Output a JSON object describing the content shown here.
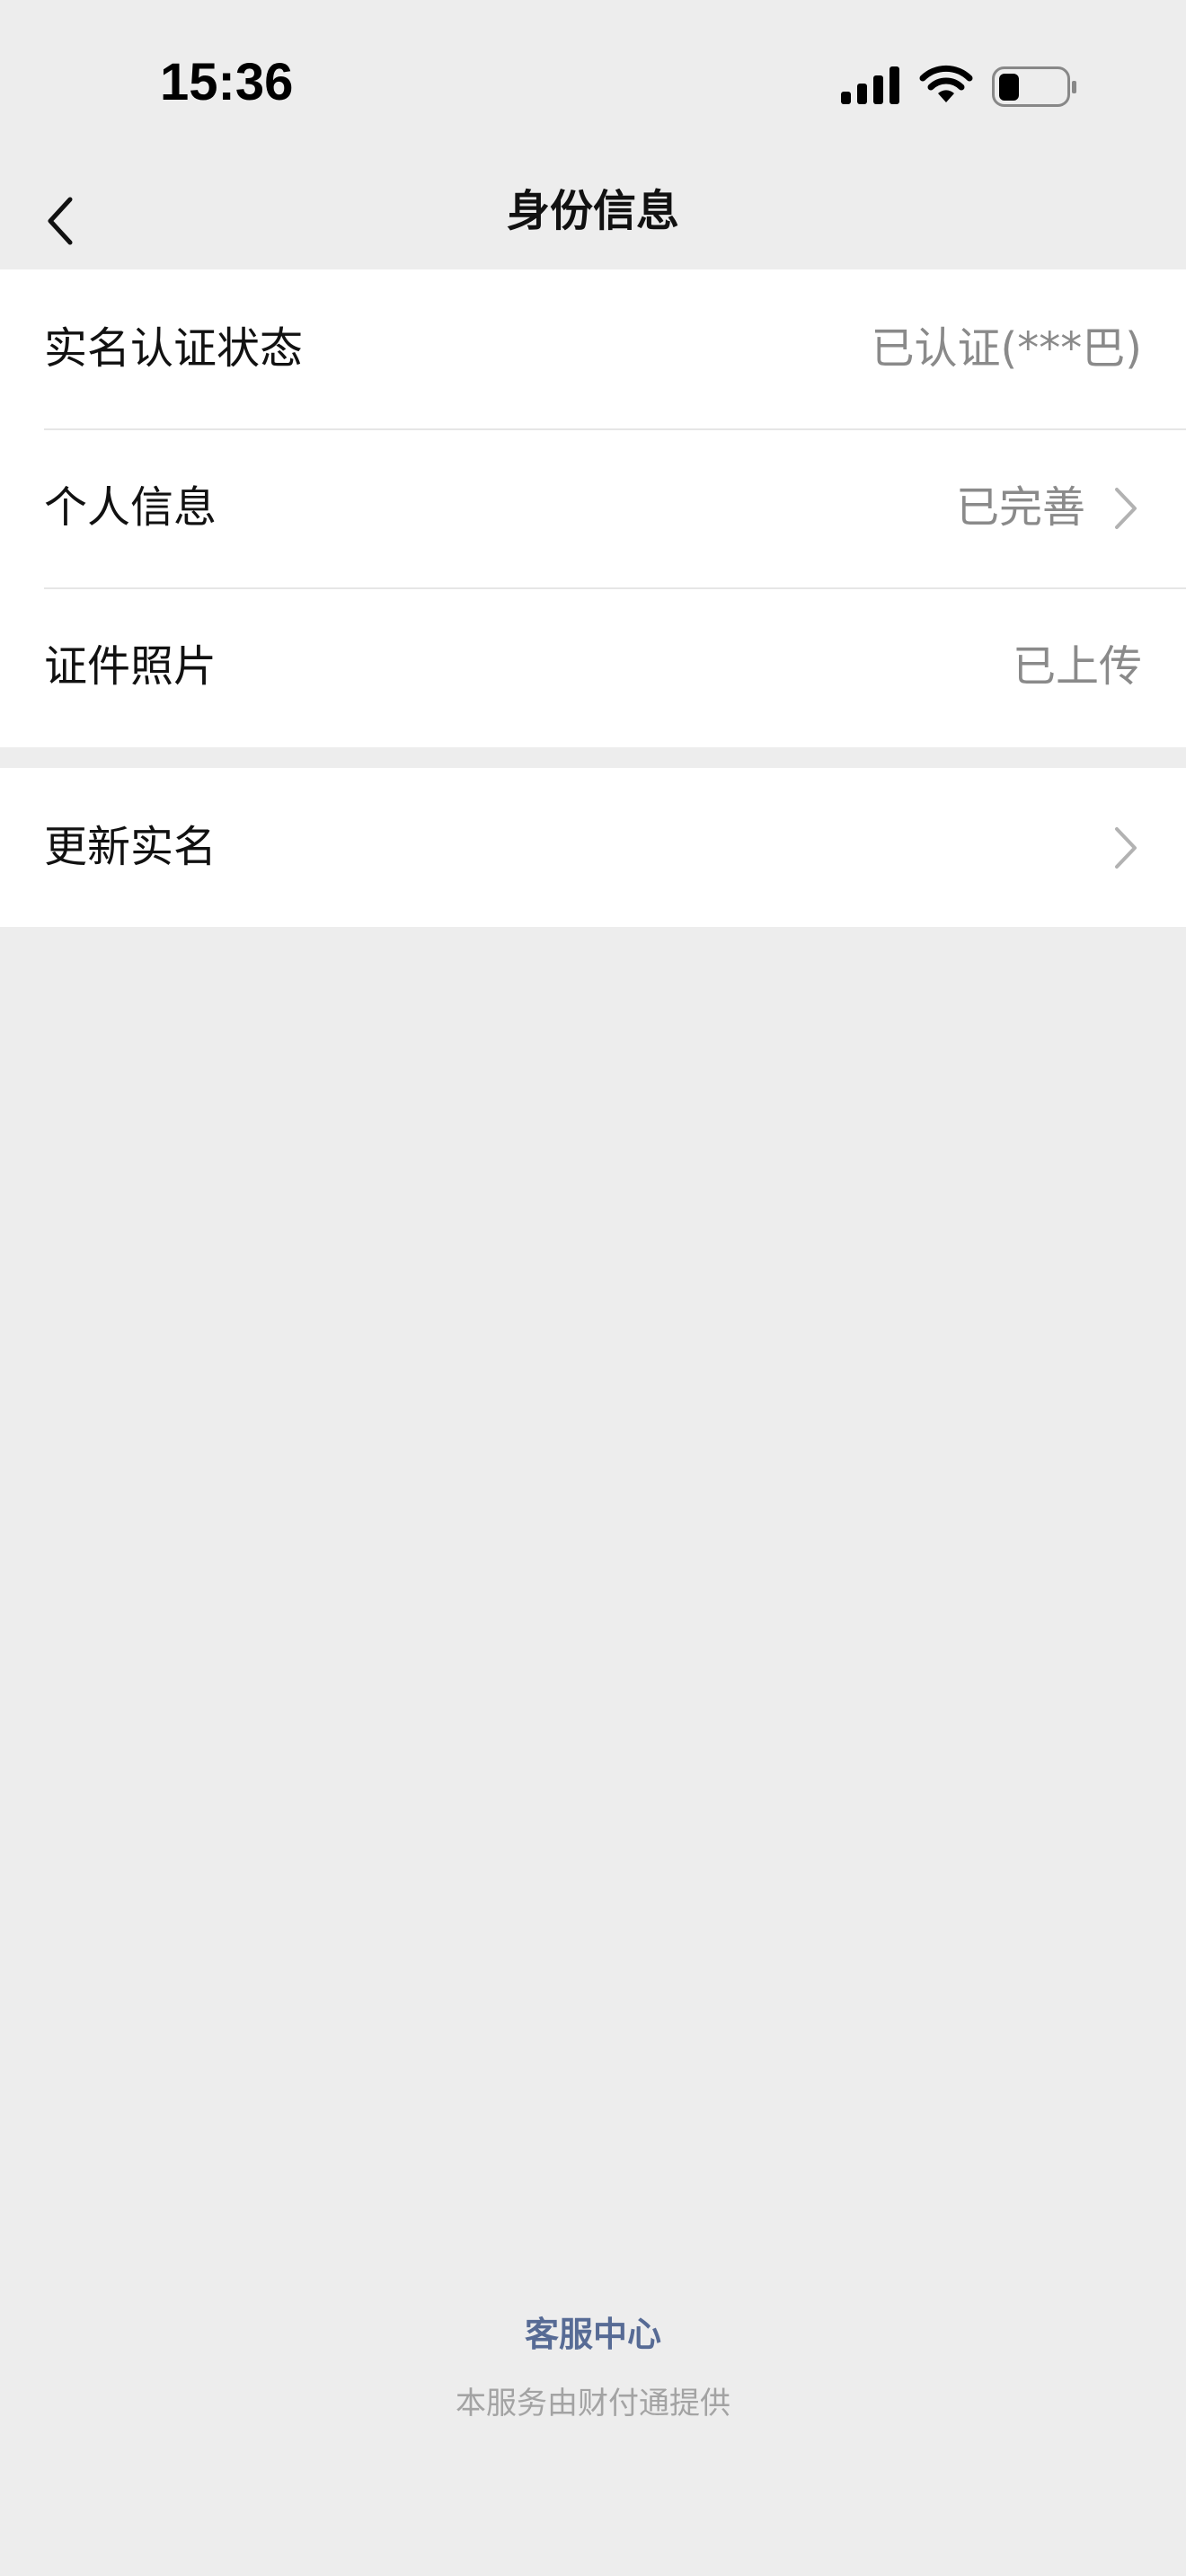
{
  "status_bar": {
    "time": "15:36",
    "icons": [
      "cellular-signal-icon",
      "wifi-icon",
      "battery-icon"
    ]
  },
  "nav": {
    "title": "身份信息",
    "back_icon": "chevron-left-icon"
  },
  "groups": [
    {
      "rows": [
        {
          "label": "实名认证状态",
          "value": "已认证(***巴)",
          "has_chevron": false
        },
        {
          "label": "个人信息",
          "value": "已完善",
          "has_chevron": true
        },
        {
          "label": "证件照片",
          "value": "已上传",
          "has_chevron": false
        }
      ]
    },
    {
      "rows": [
        {
          "label": "更新实名",
          "value": "",
          "has_chevron": true
        }
      ]
    }
  ],
  "footer": {
    "link": "客服中心",
    "provider": "本服务由财付通提供"
  },
  "colors": {
    "background": "#ededed",
    "card": "#ffffff",
    "link": "#576b95",
    "secondary_text": "#8a8a8a"
  }
}
